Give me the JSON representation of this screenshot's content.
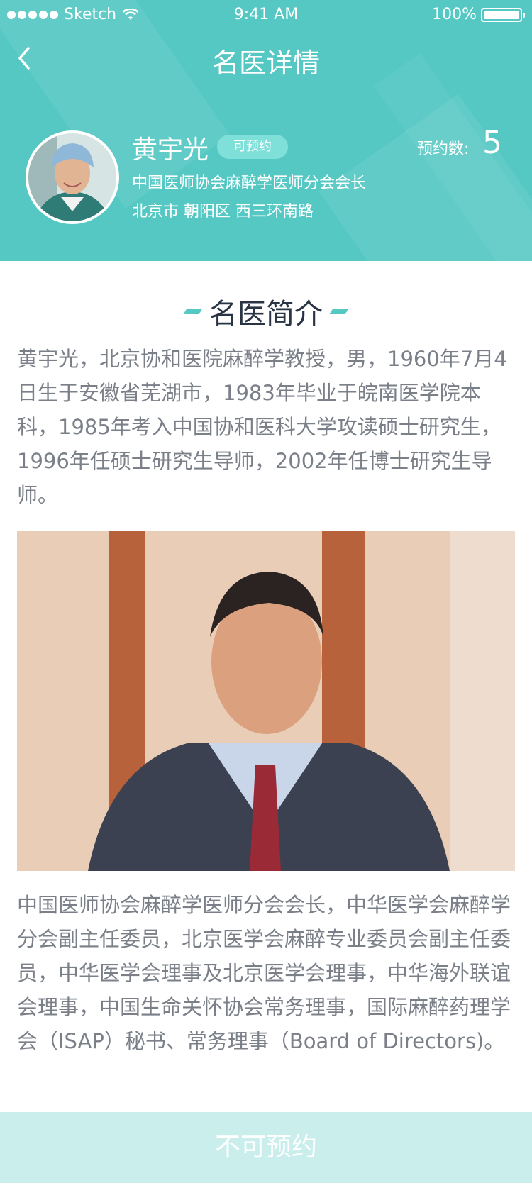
{
  "status_bar": {
    "carrier": "Sketch",
    "time": "9:41 AM",
    "battery": "100%",
    "battery_level": 1.0
  },
  "header": {
    "title": "名医详情"
  },
  "doctor": {
    "name": "黄宇光",
    "status_badge": "可预约",
    "appointment_label": "预约数:",
    "appointment_count": "5",
    "position": "中国医师协会麻醉学医师分会会长",
    "address": "北京市 朝阳区 西三环南路"
  },
  "section": {
    "title": "名医简介"
  },
  "intro_text": "黄宇光，北京协和医院麻醉学教授，男，1960年7月4日生于安徽省芜湖市，1983年毕业于皖南医学院本科，1985年考入中国协和医科大学攻读硕士研究生，1996年任硕士研究生导师，2002年任博士研究生导师。",
  "description": "中国医师协会麻醉学医师分会会长，中华医学会麻醉学分会副主任委员，北京医学会麻醉专业委员会副主任委员，中华医学会理事及北京医学会理事，中华海外联谊会理事，中国生命关怀协会常务理事，国际麻醉药理学会（ISAP）秘书、常务理事（Board of Directors)。",
  "footer": {
    "book_button": "不可预约"
  },
  "colors": {
    "primary": "#55c8c4",
    "badge": "#7fe0d9",
    "button_disabled": "#c9eeeb",
    "body_text": "#7a7f88"
  },
  "icons": {
    "back": "chevron-left-icon",
    "wifi": "wifi-icon",
    "battery": "battery-icon"
  }
}
